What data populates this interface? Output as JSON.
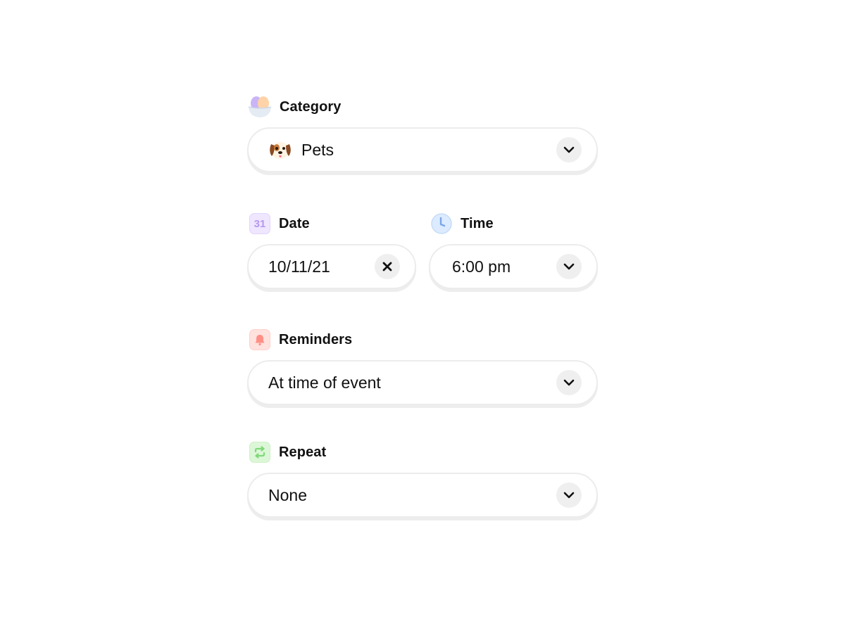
{
  "category": {
    "label": "Category",
    "icon": "category-bowl-icon",
    "value": "Pets",
    "value_icon": "dog-face-icon"
  },
  "date": {
    "label": "Date",
    "icon_text": "31",
    "value": "10/11/21"
  },
  "time": {
    "label": "Time",
    "icon": "clock-icon",
    "value": "6:00 pm"
  },
  "reminders": {
    "label": "Reminders",
    "icon": "bell-icon",
    "value": "At time of event"
  },
  "repeat": {
    "label": "Repeat",
    "icon": "repeat-icon",
    "value": "None"
  },
  "colors": {
    "calendar_bg": "#efe6ff",
    "calendar_text": "#b598ee",
    "clock_bg": "#dcebff",
    "bell_bg": "#ffe1de",
    "bell_fg": "#ff8f86",
    "repeat_bg": "#dcf7d7",
    "repeat_fg": "#7fd97a"
  }
}
